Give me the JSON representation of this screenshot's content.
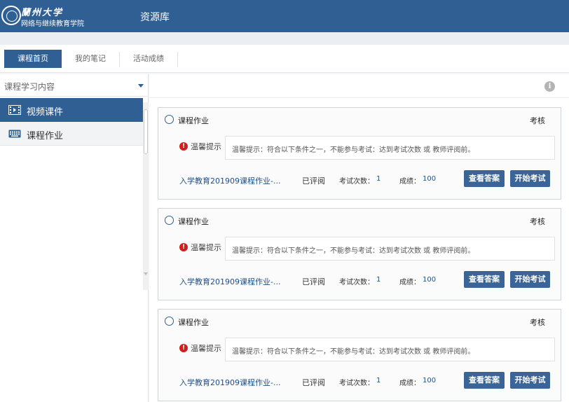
{
  "header": {
    "logo_title": "蘭州大学",
    "logo_sub": "网络与继续教育学院",
    "title": "资源库",
    "brand_color": "#2f5f93"
  },
  "tabs": [
    {
      "label": "课程首页",
      "active": true
    },
    {
      "label": "我的笔记",
      "active": false
    },
    {
      "label": "活动成绩",
      "active": false
    }
  ],
  "sidebar": {
    "title": "课程学习内容",
    "items": [
      {
        "label": "视频课件",
        "icon": "film-icon",
        "active": true
      },
      {
        "label": "课程作业",
        "icon": "keyboard-icon",
        "active": false
      }
    ]
  },
  "assignments": [
    {
      "title": "课程作业",
      "tag": "考核",
      "alert_label": "温馨提示",
      "notice": "温馨提示：符合以下条件之一，不能参与考试：达到考试次数 或 教师评阅前。",
      "link": "入学教育201909课程作业-...",
      "status": "已评阅",
      "tries_label": "考试次数：",
      "tries": "1",
      "score_label": "成绩：",
      "score": "100",
      "answer_button": "查看答案",
      "start_button": "开始考试"
    },
    {
      "title": "课程作业",
      "tag": "考核",
      "alert_label": "温馨提示",
      "notice": "温馨提示：符合以下条件之一，不能参与考试：达到考试次数 或 教师评阅前。",
      "link": "入学教育201909课程作业-...",
      "status": "已评阅",
      "tries_label": "考试次数：",
      "tries": "1",
      "score_label": "成绩：",
      "score": "100",
      "answer_button": "查看答案",
      "start_button": "开始考试"
    },
    {
      "title": "课程作业",
      "tag": "考核",
      "alert_label": "温馨提示",
      "notice": "温馨提示：符合以下条件之一，不能参与考试：达到考试次数 或 教师评阅前。",
      "link": "入学教育201909课程作业-...",
      "status": "已评阅",
      "tries_label": "考试次数：",
      "tries": "1",
      "score_label": "成绩：",
      "score": "100",
      "answer_button": "查看答案",
      "start_button": "开始考试"
    }
  ]
}
